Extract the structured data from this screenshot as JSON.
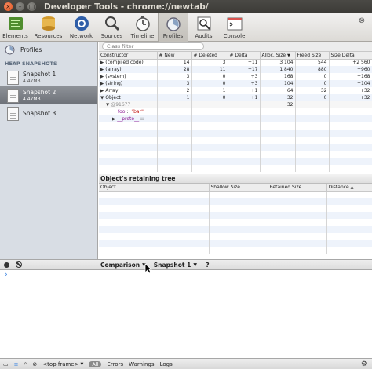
{
  "window": {
    "title": "Developer Tools - chrome://newtab/",
    "close_glyph": "×",
    "min_glyph": "–",
    "max_glyph": "□"
  },
  "toolbar": {
    "items": [
      {
        "label": "Elements",
        "icon": "elements-icon"
      },
      {
        "label": "Resources",
        "icon": "resources-icon"
      },
      {
        "label": "Network",
        "icon": "network-icon"
      },
      {
        "label": "Sources",
        "icon": "sources-icon"
      },
      {
        "label": "Timeline",
        "icon": "timeline-icon"
      },
      {
        "label": "Profiles",
        "icon": "profiles-icon"
      },
      {
        "label": "Audits",
        "icon": "audits-icon"
      },
      {
        "label": "Console",
        "icon": "console-icon"
      }
    ],
    "active": "Profiles",
    "close_glyph": "⊗"
  },
  "sidebar": {
    "profiles_label": "Profiles",
    "section_title": "HEAP SNAPSHOTS",
    "snapshots": [
      {
        "title": "Snapshot 1",
        "size": "4.47MB"
      },
      {
        "title": "Snapshot 2",
        "size": "4.47MB"
      },
      {
        "title": "Snapshot 3",
        "size": ""
      }
    ],
    "selected_index": 1
  },
  "filter": {
    "placeholder": "Class filter"
  },
  "comparison_table": {
    "columns": [
      "Constructor",
      "# New",
      "# Deleted",
      "# Delta",
      "Alloc. Size",
      "Freed Size",
      "Size Delta"
    ],
    "sorted_column": "Alloc. Size",
    "sort_glyph": "▼",
    "rows": [
      {
        "tri": "▶",
        "constructor": "(compiled code)",
        "new": "14",
        "deleted": "3",
        "delta": "+11",
        "alloc": "3 104",
        "freed": "544",
        "size_delta": "+2 560"
      },
      {
        "tri": "▶",
        "constructor": "(array)",
        "new": "28",
        "deleted": "11",
        "delta": "+17",
        "alloc": "1 840",
        "freed": "880",
        "size_delta": "+960"
      },
      {
        "tri": "▶",
        "constructor": "(system)",
        "new": "3",
        "deleted": "0",
        "delta": "+3",
        "alloc": "168",
        "freed": "0",
        "size_delta": "+168"
      },
      {
        "tri": "▶",
        "constructor": "(string)",
        "new": "3",
        "deleted": "0",
        "delta": "+3",
        "alloc": "104",
        "freed": "0",
        "size_delta": "+104"
      },
      {
        "tri": "▶",
        "constructor": "Array",
        "new": "2",
        "deleted": "1",
        "delta": "+1",
        "alloc": "64",
        "freed": "32",
        "size_delta": "+32"
      },
      {
        "tri": "▼",
        "constructor": "Object",
        "new": "1",
        "deleted": "0",
        "delta": "+1",
        "alloc": "32",
        "freed": "0",
        "size_delta": "+32"
      }
    ],
    "expanded": {
      "instance_id": "@91677",
      "instance_new": "·",
      "instance_alloc": "32",
      "prop_name": "foo",
      "prop_sep": "::",
      "prop_value": "\"bar\"",
      "proto_name": "__proto__",
      "proto_sep": "::"
    }
  },
  "retaining_tree": {
    "title": "Object's retaining tree",
    "columns": [
      "Object",
      "Shallow Size",
      "Retained Size",
      "Distance"
    ],
    "sort_glyph": "▲"
  },
  "statusbar": {
    "view_select": "Comparison",
    "base_select": "Snapshot 1",
    "help": "?",
    "arrow_glyph": "▼"
  },
  "console": {
    "prompt": "›"
  },
  "bottombar": {
    "frame_select": "<top frame>",
    "filter_all": "All",
    "filters": [
      "Errors",
      "Warnings",
      "Logs"
    ]
  }
}
